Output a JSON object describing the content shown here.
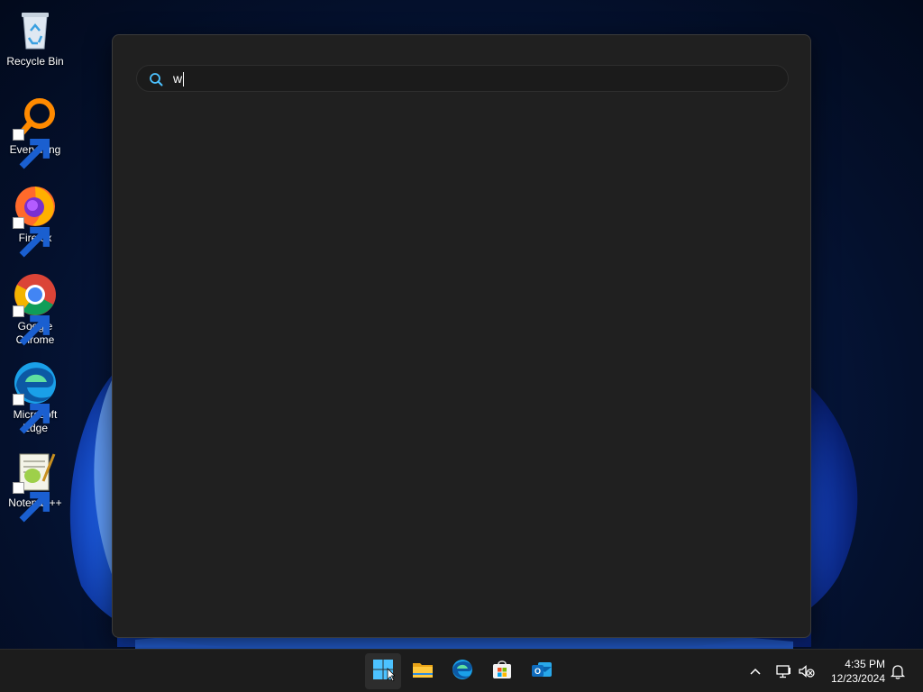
{
  "desktop": {
    "icons": [
      {
        "label": "Recycle Bin",
        "icon": "recycle-bin-icon",
        "shortcut": false
      },
      {
        "label": "Everything",
        "icon": "everything-icon",
        "shortcut": true
      },
      {
        "label": "Firefox",
        "icon": "firefox-icon",
        "shortcut": true
      },
      {
        "label": "Google Chrome",
        "icon": "chrome-icon",
        "shortcut": true
      },
      {
        "label": "Microsoft Edge",
        "icon": "edge-icon",
        "shortcut": true
      },
      {
        "label": "Notepad++",
        "icon": "notepadpp-icon",
        "shortcut": true
      }
    ]
  },
  "start_panel": {
    "search": {
      "value": "w",
      "placeholder": ""
    }
  },
  "taskbar": {
    "pinned": [
      {
        "name": "Start",
        "icon": "windows-start-icon",
        "active": true
      },
      {
        "name": "File Explorer",
        "icon": "file-explorer-icon",
        "active": false
      },
      {
        "name": "Microsoft Edge",
        "icon": "edge-icon",
        "active": false
      },
      {
        "name": "Microsoft Store",
        "icon": "store-icon",
        "active": false
      },
      {
        "name": "Outlook (new)",
        "icon": "outlook-icon",
        "active": false
      }
    ],
    "tray": {
      "show_hidden": "chevron-up-icon",
      "network": "network-icon",
      "volume": "volume-muted-icon",
      "time": "4:35 PM",
      "date": "12/23/2024",
      "notifications": "bell-icon"
    }
  },
  "colors": {
    "panel_bg": "#202020",
    "taskbar_bg": "#1c1c1c",
    "accent": "#4cc2ff"
  }
}
